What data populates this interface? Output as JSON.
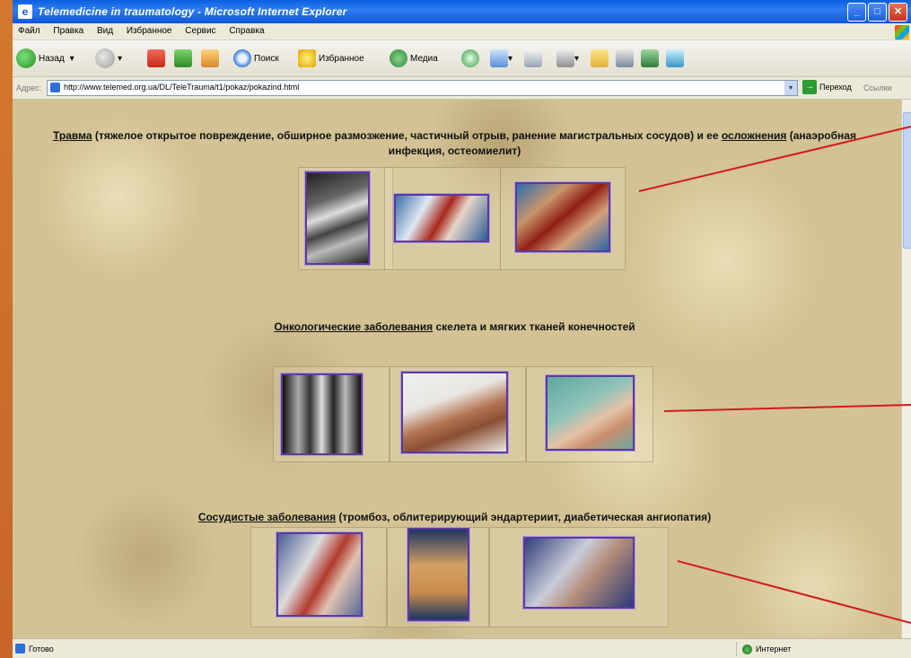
{
  "window": {
    "title": "Telemedicine in traumatology - Microsoft Internet Explorer",
    "controls": {
      "minimize": "_",
      "maximize": "□",
      "close": "✕"
    }
  },
  "menu": [
    "Файл",
    "Правка",
    "Вид",
    "Избранное",
    "Сервис",
    "Справка"
  ],
  "toolbar": {
    "back_label": "Назад",
    "search_label": "Поиск",
    "favorites_label": "Избранное",
    "media_label": "Медиа",
    "dropdown_glyph": "▾"
  },
  "address": {
    "label": "Адрес:",
    "url": "http://www.telemed.org.ua/DL/TeleTrauma/t1/pokaz/pokazind.html",
    "go_label": "Переход",
    "links_label": "Ссылки"
  },
  "sections": {
    "trauma": {
      "link": "Травма",
      "text1": " (тяжелое открытое повреждение, обширное размозжение, частичный отрыв, ранение магистральных сосудов) и ее ",
      "link2": "осложнения",
      "text2": " (анаэробная инфекция, остеомиелит)"
    },
    "oncology": {
      "link": "Онкологические заболевания",
      "text": " скелета и мягких тканей конечностей"
    },
    "vascular": {
      "link": "Сосудистые заболевания",
      "text": " (тромбоз, облитерирующий эндартериит, диабетическая ангиопатия)"
    }
  },
  "status": {
    "text": "Готово",
    "zone": "Интернет"
  },
  "colors": {
    "annotation_line": "#d41a1a",
    "photo_border": "#5b3a9e",
    "titlebar": "#0f56d8"
  }
}
